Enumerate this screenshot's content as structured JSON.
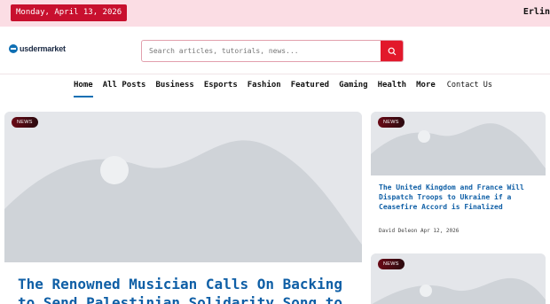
{
  "topbar": {
    "date": "Monday, April 13, 2026",
    "user": "Erlin"
  },
  "header": {
    "logo_text": "usdermarket",
    "search": {
      "placeholder": "Search articles, tutorials, news...",
      "value": ""
    }
  },
  "nav": {
    "items": [
      {
        "label": "Home"
      },
      {
        "label": "All Posts"
      },
      {
        "label": "Business"
      },
      {
        "label": "Esports"
      },
      {
        "label": "Fashion"
      },
      {
        "label": "Featured"
      },
      {
        "label": "Gaming"
      },
      {
        "label": "Health"
      },
      {
        "label": "More"
      },
      {
        "label": "Contact Us"
      }
    ]
  },
  "main_article": {
    "tag": "NEWS",
    "title": "The Renowned Musician Calls On Backing to Send Palestinian Solidarity Song to"
  },
  "side_articles": [
    {
      "tag": "NEWS",
      "title": "The United Kingdom and France Will Dispatch Troops to Ukraine if a Ceasefire Accord is Finalized",
      "meta": "David Deleon Apr 12, 2026"
    },
    {
      "tag": "NEWS"
    }
  ],
  "colors": {
    "accent_red": "#c8102e",
    "link_blue": "#0f5fa6",
    "topbar_pink": "#fbdde4"
  }
}
